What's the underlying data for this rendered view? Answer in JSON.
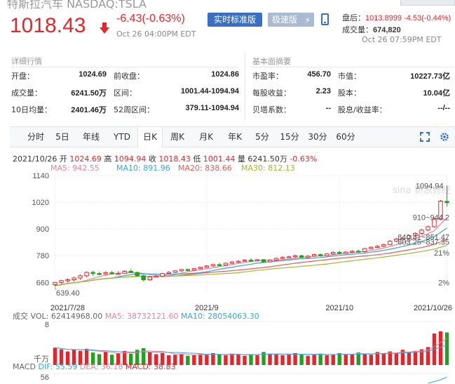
{
  "header": {
    "stock_name": "特斯拉汽车 NASDAQ:TSLA",
    "price": "1018.43",
    "change": "-6.43(-0.63%)",
    "time": "Oct 26 04:00PM EDT",
    "btn_realtime": "实时标准版",
    "btn_fast": "极速版",
    "after_hours_label": "盘后：",
    "after_hours_value": "1013.8999  -4.53(-0.44%)",
    "volume_label": "成交量：",
    "volume_value": "674,820",
    "after_hours_time": "Oct 26 07:59PM EDT"
  },
  "detail": {
    "title": "详细行情",
    "rows": [
      {
        "k1": "开盘：",
        "v1": "1024.69",
        "k2": "前收盘：",
        "v2": "1024.86"
      },
      {
        "k1": "成交量：",
        "v1": "6241.50万",
        "k2": "区间：",
        "v2": "1001.44-1094.94"
      },
      {
        "k1": "10日均量：",
        "v1": "2401.46万",
        "k2": "52周区间：",
        "v2": "379.11-1094.94"
      }
    ]
  },
  "fundamentals": {
    "title": "基本面摘要",
    "rows": [
      {
        "k1": "市盈率：",
        "v1": "456.70",
        "k2": "市值：",
        "v2": "10227.73亿"
      },
      {
        "k1": "每股收益：",
        "v1": "2.23",
        "k2": "股本：",
        "v2": "10.04亿"
      },
      {
        "k1": "贝塔系数：",
        "v1": "--",
        "k2": "股息/收益率：",
        "v2": "--/--"
      }
    ]
  },
  "tabs": [
    "分时",
    "5日",
    "年线",
    "YTD",
    "日K",
    "周K",
    "月K",
    "年K",
    "5分",
    "15分",
    "30分",
    "60分"
  ],
  "active_tab": "日K",
  "chart_info": {
    "date": "2021/10/26",
    "open_label": "开",
    "open": "1024.69",
    "high_label": "高",
    "high": "1094.94",
    "close_label": "收",
    "close": "1018.43",
    "low_label": "低",
    "low": "1001.44",
    "vol_label": "量",
    "vol": "6241.50万",
    "pct": "-0.63%"
  },
  "ma": {
    "ma5": "MA5: 942.55",
    "ma10": "MA10: 891.96",
    "ma20": "MA20: 838.66",
    "ma30": "MA30: 812.13"
  },
  "colors": {
    "up": "#e4262c",
    "down": "#1fa31f",
    "ma5": "#e7829d",
    "ma10": "#36a6d6",
    "ma20": "#e95b5b",
    "ma30": "#a5b82e"
  },
  "watermark": "sina 新浪财经",
  "volume_header": {
    "label": "成交",
    "vol": "VOL: 62414968.00",
    "ma5": "MA5: 38732121.60",
    "ma10": "MA10: 28054063.30"
  },
  "macd_header": {
    "label": "MACD",
    "dif": "DIF: 55.59",
    "dea": "DEA: 36.18",
    "macd": "MACD: 38.83"
  },
  "chart_data": {
    "type": "candlestick",
    "y_ticks": [
      "1140",
      "1020",
      "900",
      "780",
      "660"
    ],
    "ylim": [
      620,
      1140
    ],
    "pct_ticks": [
      "21%",
      "2%"
    ],
    "x_ticks": [
      {
        "label": "2021/7/28",
        "index": 0
      },
      {
        "label": "2021/9",
        "index": 24
      },
      {
        "label": "2021/10",
        "index": 45
      },
      {
        "label": "2021/10/26",
        "index": 62
      }
    ],
    "annotations": [
      "1094.94",
      "639.40",
      "910~944.2",
      "840.41~851.47",
      "803.25~837.35"
    ],
    "candles": [
      [
        650,
        660,
        645,
        642,
        661
      ],
      [
        660,
        668,
        655,
        652,
        672
      ],
      [
        668,
        672,
        665,
        660,
        678
      ],
      [
        672,
        680,
        668,
        665,
        685
      ],
      [
        680,
        690,
        676,
        672,
        695
      ],
      [
        690,
        705,
        686,
        682,
        710
      ],
      [
        705,
        700,
        695,
        690,
        712
      ],
      [
        700,
        698,
        702,
        692,
        708
      ],
      [
        698,
        704,
        700,
        695,
        710
      ],
      [
        704,
        700,
        703,
        698,
        712
      ],
      [
        700,
        700,
        706,
        695,
        710
      ],
      [
        700,
        710,
        705,
        700,
        715
      ],
      [
        710,
        705,
        700,
        702,
        720
      ],
      [
        705,
        690,
        703,
        685,
        708
      ],
      [
        690,
        672,
        688,
        665,
        695
      ],
      [
        672,
        685,
        680,
        668,
        690
      ],
      [
        685,
        688,
        690,
        682,
        695
      ],
      [
        688,
        700,
        694,
        685,
        703
      ],
      [
        700,
        705,
        702,
        698,
        710
      ],
      [
        705,
        712,
        708,
        702,
        716
      ],
      [
        712,
        718,
        714,
        708,
        720
      ],
      [
        718,
        715,
        720,
        710,
        722
      ],
      [
        715,
        722,
        718,
        712,
        725
      ],
      [
        722,
        728,
        724,
        720,
        730
      ],
      [
        728,
        734,
        730,
        725,
        738
      ],
      [
        734,
        740,
        736,
        730,
        745
      ],
      [
        740,
        738,
        745,
        735,
        748
      ],
      [
        738,
        746,
        742,
        735,
        750
      ],
      [
        746,
        752,
        748,
        742,
        756
      ],
      [
        752,
        755,
        756,
        748,
        760
      ],
      [
        755,
        760,
        758,
        752,
        765
      ],
      [
        760,
        758,
        764,
        754,
        768
      ],
      [
        758,
        762,
        760,
        755,
        766
      ],
      [
        762,
        752,
        758,
        748,
        765
      ],
      [
        752,
        760,
        756,
        750,
        764
      ],
      [
        760,
        768,
        764,
        755,
        772
      ],
      [
        768,
        772,
        770,
        765,
        778
      ],
      [
        772,
        775,
        774,
        768,
        780
      ],
      [
        775,
        780,
        778,
        770,
        784
      ],
      [
        780,
        772,
        778,
        768,
        784
      ],
      [
        772,
        778,
        775,
        770,
        782
      ],
      [
        778,
        785,
        782,
        775,
        790
      ],
      [
        785,
        780,
        786,
        776,
        790
      ],
      [
        780,
        788,
        784,
        778,
        792
      ],
      [
        788,
        795,
        792,
        784,
        800
      ],
      [
        795,
        790,
        798,
        786,
        802
      ],
      [
        790,
        796,
        794,
        788,
        800
      ],
      [
        796,
        800,
        798,
        792,
        805
      ],
      [
        800,
        798,
        804,
        794,
        808
      ],
      [
        798,
        812,
        806,
        795,
        815
      ],
      [
        812,
        818,
        815,
        808,
        822
      ],
      [
        818,
        822,
        820,
        815,
        828
      ],
      [
        822,
        830,
        826,
        818,
        834
      ],
      [
        830,
        845,
        838,
        828,
        850
      ],
      [
        845,
        855,
        852,
        840,
        860
      ],
      [
        855,
        858,
        860,
        850,
        866
      ],
      [
        858,
        870,
        864,
        855,
        875
      ],
      [
        870,
        880,
        876,
        865,
        885
      ],
      [
        880,
        895,
        888,
        875,
        900
      ],
      [
        895,
        910,
        905,
        890,
        915
      ],
      [
        910,
        944,
        930,
        905,
        950
      ],
      [
        944,
        1025,
        1010,
        940,
        1030
      ],
      [
        1024,
        1018,
        1024,
        1001,
        1095
      ]
    ],
    "volume": [
      3.2,
      2.9,
      2.5,
      2.8,
      2.6,
      3.0,
      2.3,
      2.0,
      2.4,
      1.9,
      2.2,
      2.6,
      2.1,
      2.8,
      3.1,
      2.4,
      2.0,
      2.2,
      1.8,
      1.9,
      2.1,
      1.7,
      1.8,
      2.0,
      1.9,
      2.2,
      2.0,
      1.8,
      2.1,
      1.9,
      1.7,
      2.0,
      1.8,
      2.4,
      2.1,
      2.0,
      1.8,
      1.9,
      2.2,
      2.0,
      1.7,
      1.9,
      2.1,
      1.8,
      2.0,
      2.2,
      1.9,
      2.0,
      2.3,
      2.1,
      1.9,
      2.4,
      2.1,
      2.5,
      2.2,
      2.8,
      2.4,
      2.6,
      2.9,
      3.3,
      5.8,
      6.2,
      6.0
    ],
    "volume_unit": "千万",
    "volume_ylim": [
      0,
      8
    ]
  }
}
